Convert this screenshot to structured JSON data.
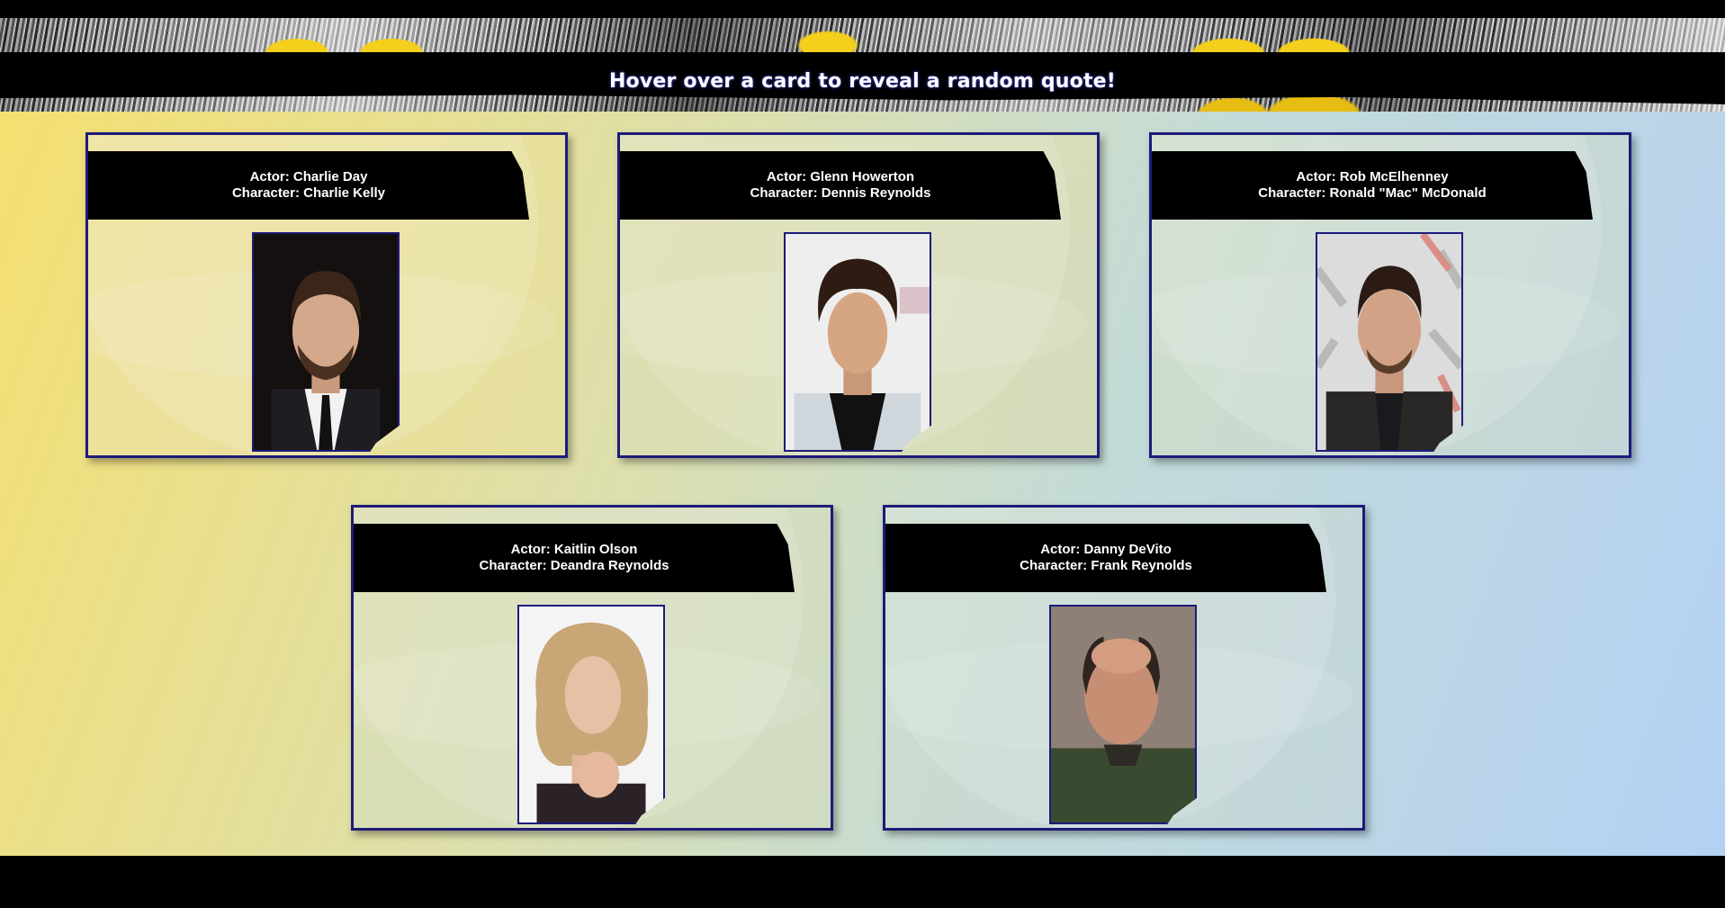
{
  "header": {
    "instruction": "Hover over a card to reveal a random quote!"
  },
  "cards": [
    {
      "actor": "Actor: Charlie Day",
      "character": "Character: Charlie Kelly"
    },
    {
      "actor": "Actor: Glenn Howerton",
      "character": "Character: Dennis Reynolds"
    },
    {
      "actor": "Actor: Rob McElhenney",
      "character": "Character: Ronald \"Mac\" McDonald"
    },
    {
      "actor": "Actor: Kaitlin Olson",
      "character": "Character: Deandra Reynolds"
    },
    {
      "actor": "Actor: Danny DeVito",
      "character": "Character: Frank Reynolds"
    }
  ],
  "colors": {
    "card_border": "#1d1b7a",
    "header_bg": "#000000",
    "title_glow": "#3b3bd0"
  }
}
